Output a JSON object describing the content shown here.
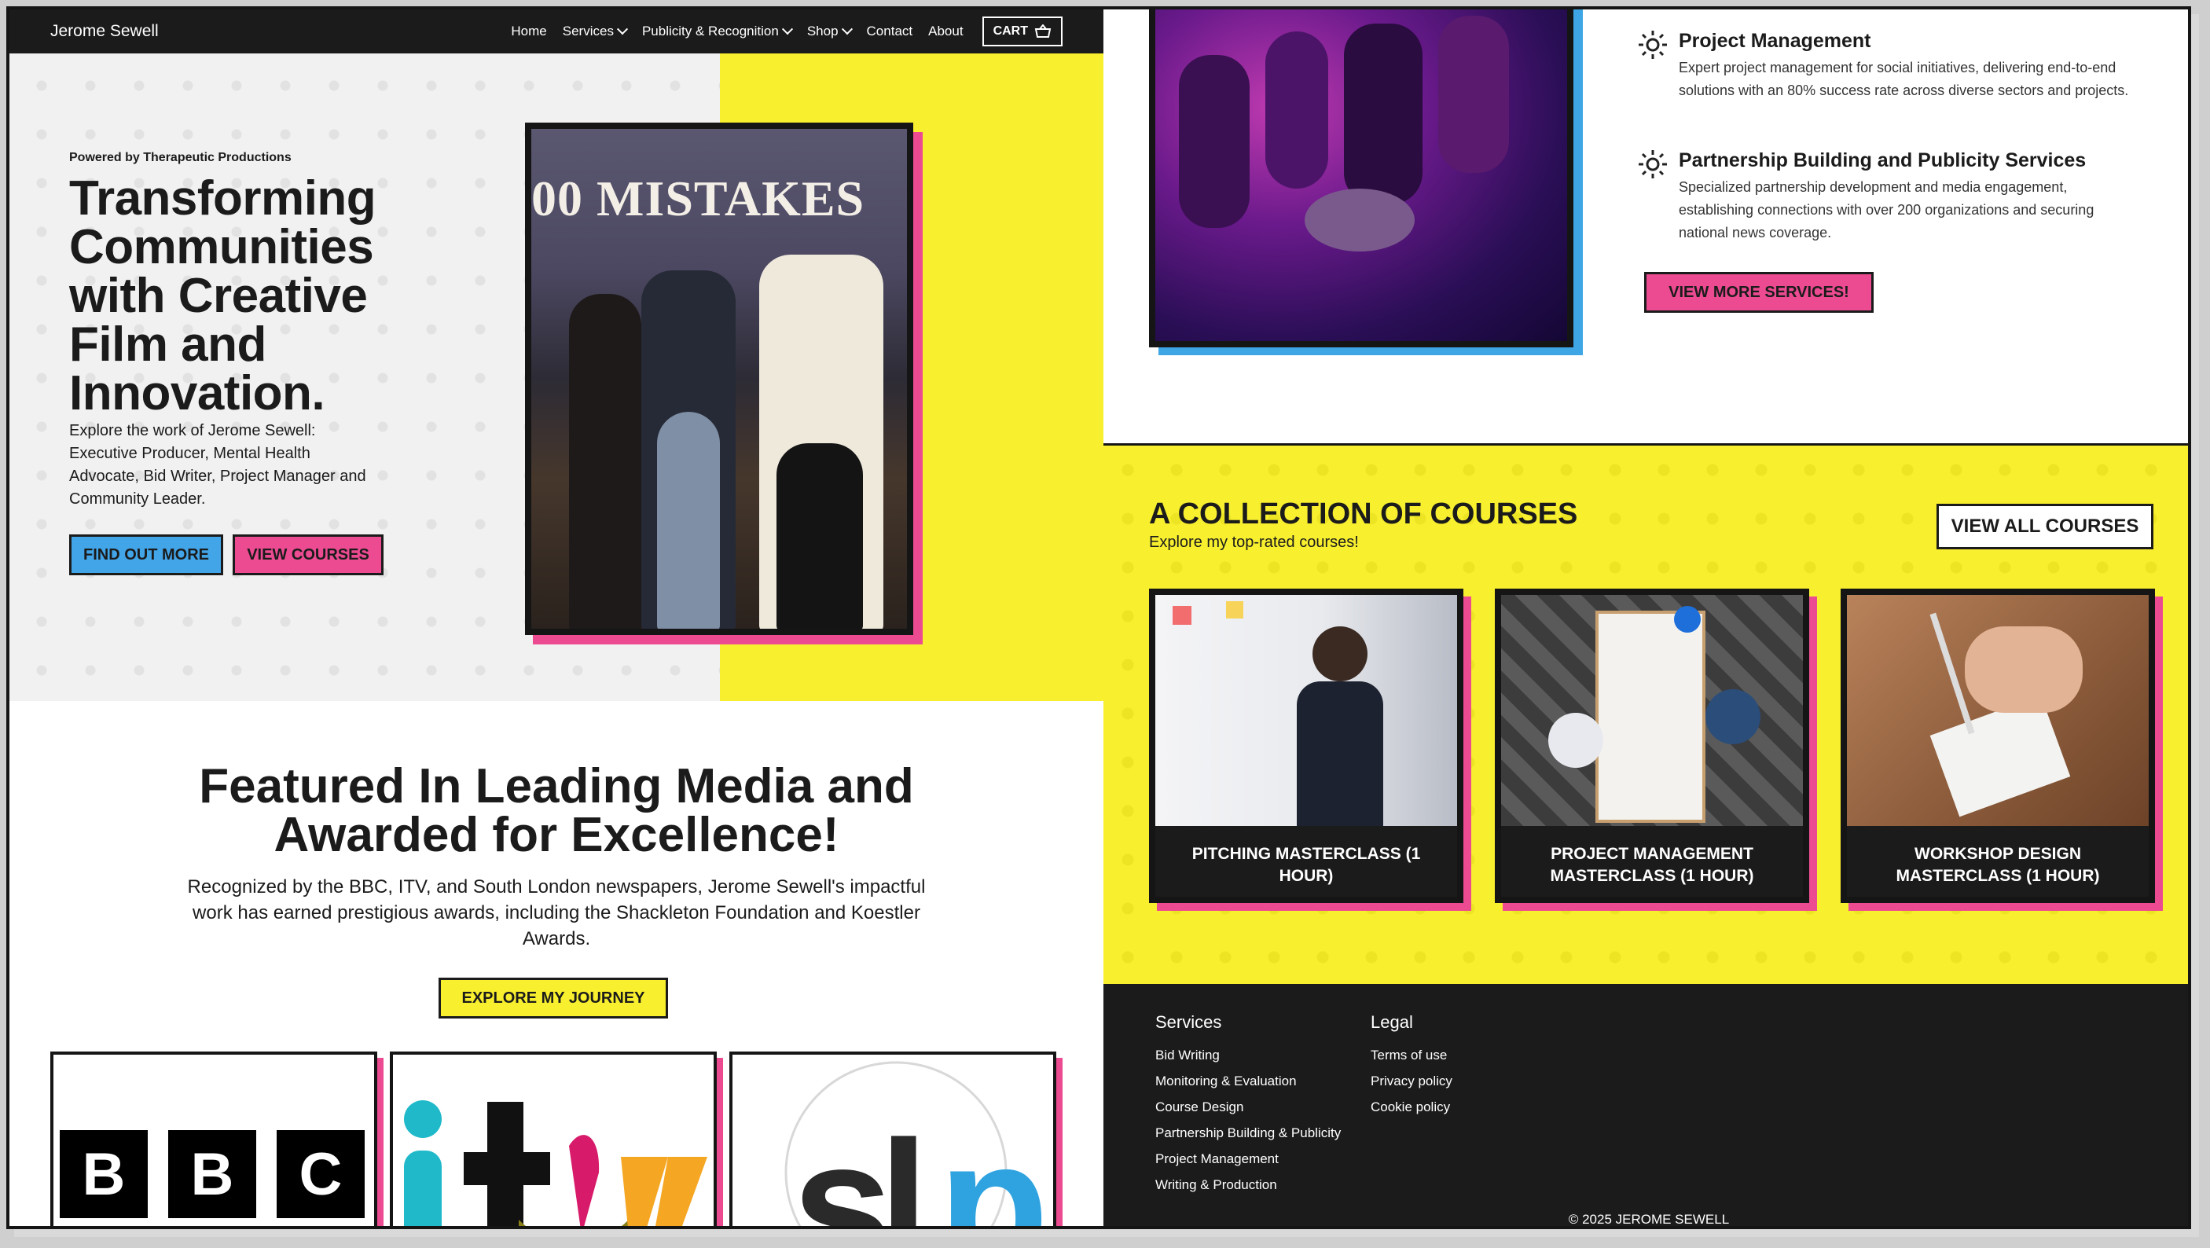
{
  "nav": {
    "brand": "Jerome Sewell",
    "items": [
      "Home",
      "Services",
      "Publicity & Recognition",
      "Shop",
      "Contact",
      "About"
    ],
    "cart": "CART"
  },
  "hero": {
    "powered": "Powered by Therapeutic Productions",
    "title": "Transforming Communities with Creative Film and Innovation.",
    "subtitle": "Explore the work of Jerome Sewell: Executive Producer, Mental Health Advocate, Bid Writer, Project Manager and Community Leader.",
    "btn_find": "FIND OUT MORE",
    "btn_courses": "VIEW COURSES",
    "photo_banner": "00 MISTAKES"
  },
  "featured": {
    "title": "Featured In Leading Media and Awarded for Excellence!",
    "subtitle": "Recognized by the BBC, ITV, and South London newspapers, Jerome Sewell's impactful work has earned prestigious awards, including the Shackleton Foundation and Koestler Awards.",
    "btn": "EXPLORE MY JOURNEY",
    "logos": [
      {
        "letters": [
          "B",
          "B",
          "C"
        ]
      },
      {
        "text": "itv"
      },
      {
        "text": "slp"
      }
    ]
  },
  "services": {
    "items": [
      {
        "title": "Project Management",
        "desc": "Expert project management for social initiatives, delivering end-to-end solutions with an 80% success rate across diverse sectors and projects."
      },
      {
        "title": "Partnership Building and Publicity Services",
        "desc": "Specialized partnership development and media engagement, establishing connections with over 200 organizations and securing national news coverage."
      }
    ],
    "btn": "VIEW MORE SERVICES!"
  },
  "courses": {
    "title": "A COLLECTION OF COURSES",
    "subtitle": "Explore my top-rated courses!",
    "btn": "VIEW ALL COURSES",
    "items": [
      {
        "label": "PITCHING MASTERCLASS (1 HOUR)"
      },
      {
        "label": "PROJECT MANAGEMENT MASTERCLASS (1 HOUR)"
      },
      {
        "label": "WORKSHOP DESIGN MASTERCLASS (1 HOUR)"
      }
    ]
  },
  "footer": {
    "services_head": "Services",
    "services": [
      "Bid Writing",
      "Monitoring & Evaluation",
      "Course Design",
      "Partnership Building & Publicity",
      "Project Management",
      "Writing & Production"
    ],
    "legal_head": "Legal",
    "legal": [
      "Terms of use",
      "Privacy policy",
      "Cookie policy"
    ],
    "copyright": "© 2025  JEROME SEWELL"
  },
  "colors": {
    "yellow": "#f8ef2f",
    "pink": "#ec4b91",
    "blue": "#42a5e8",
    "dark": "#1b1b1b"
  }
}
